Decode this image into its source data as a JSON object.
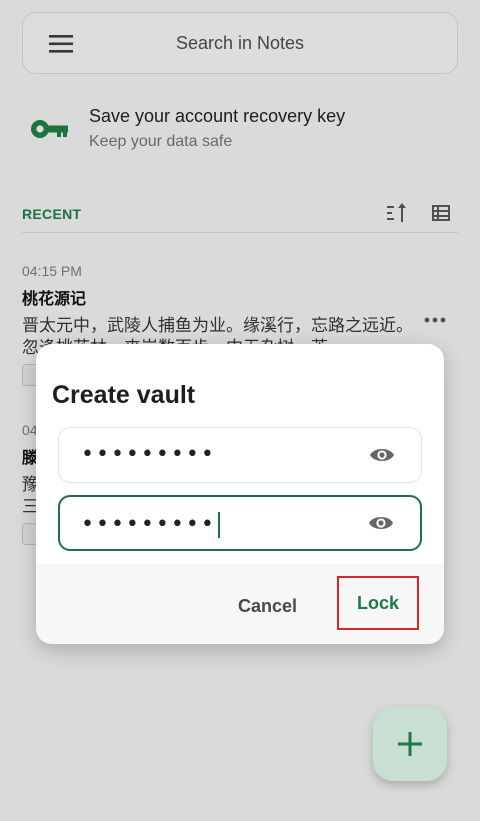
{
  "search": {
    "placeholder": "Search in Notes"
  },
  "banner": {
    "title": "Save your account recovery key",
    "subtitle": "Keep your data safe"
  },
  "recent": {
    "label": "RECENT"
  },
  "notes": [
    {
      "time": "04:15 PM",
      "title": "桃花源记",
      "body": "晋太元中，武陵人捕鱼为业。缘溪行，忘路之远近。忽逢桃花林，夹岸数百步，中无杂树，芳"
    },
    {
      "time": "04",
      "title": "滕",
      "body": "豫\n三"
    }
  ],
  "dialog": {
    "title": "Create vault",
    "password": "•••••••••",
    "confirm_password": "•••••••••",
    "cancel_label": "Cancel",
    "lock_label": "Lock"
  },
  "colors": {
    "accent": "#1f7a43",
    "highlight": "#d8262b",
    "fab": "#c9dfd2"
  },
  "icons": [
    "menu-icon",
    "key-icon",
    "sort-icon",
    "list-view-icon",
    "more-icon",
    "eye-icon",
    "plus-icon"
  ]
}
